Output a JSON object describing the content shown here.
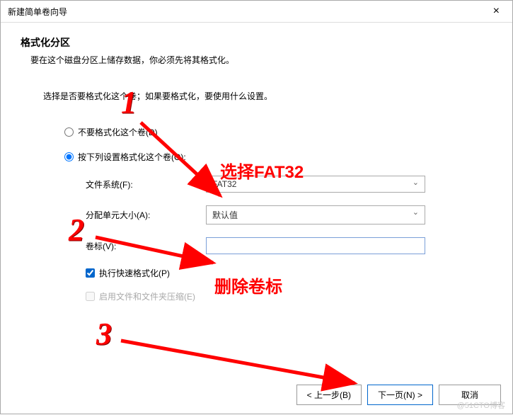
{
  "window": {
    "title": "新建简单卷向导",
    "close": "×"
  },
  "header": {
    "title": "格式化分区",
    "subtitle": "要在这个磁盘分区上储存数据，你必须先将其格式化。"
  },
  "prompt": "选择是否要格式化这个卷；如果要格式化，要使用什么设置。",
  "radios": {
    "noFormat": "不要格式化这个卷(D)",
    "formatWith": "按下列设置格式化这个卷(O):"
  },
  "fields": {
    "fs": {
      "label": "文件系统(F):",
      "value": "FAT32"
    },
    "alloc": {
      "label": "分配单元大小(A):",
      "value": "默认值"
    },
    "volLabel": {
      "label": "卷标(V):",
      "value": ""
    }
  },
  "checks": {
    "quick": "执行快速格式化(P)",
    "compress": "启用文件和文件夹压缩(E)"
  },
  "buttons": {
    "back": "< 上一步(B)",
    "next": "下一页(N) >",
    "cancel": "取消"
  },
  "annotations": {
    "n1": "1",
    "n2": "2",
    "n3": "3",
    "selectFat": "选择FAT32",
    "deleteLabel": "删除卷标"
  },
  "watermark": "@51CTO博客"
}
